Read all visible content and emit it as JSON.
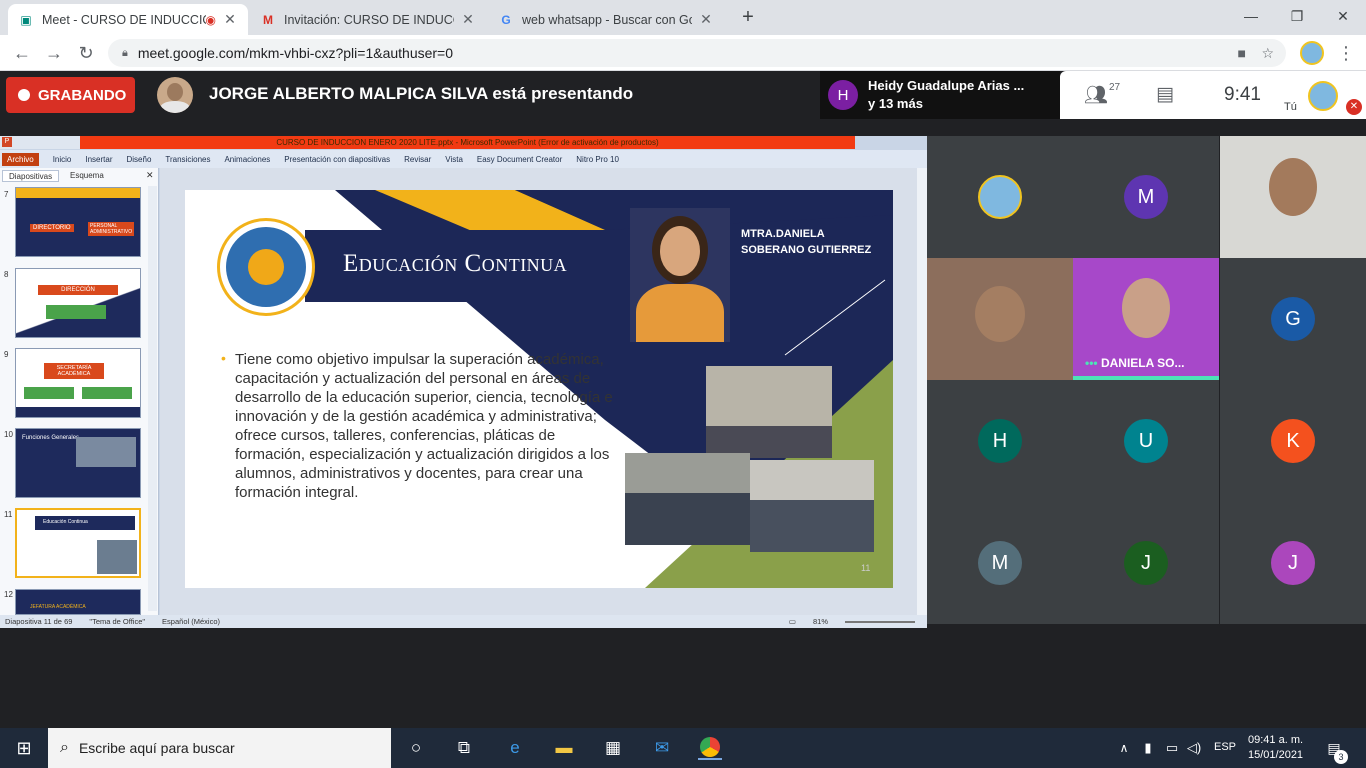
{
  "browser": {
    "tabs": [
      {
        "title": "Meet - CURSO DE INDUCCIÓN",
        "active": true
      },
      {
        "title": "Invitación: CURSO DE INDUCCIÓN"
      },
      {
        "title": "web whatsapp - Buscar con Google"
      }
    ],
    "url": "meet.google.com/mkm-vhbi-cxz?pli=1&authuser=0"
  },
  "meet": {
    "recording_label": "GRABANDO",
    "presenting_text": "JORGE ALBERTO MALPICA SILVA está presentando",
    "speaker_name": "Heidy Guadalupe Arias ...",
    "speaker_more": "y 13 más",
    "participants_count": "27",
    "time": "9:41",
    "you_label": "Tú",
    "tiles": [
      {
        "kind": "emblem"
      },
      {
        "kind": "letter",
        "letter": "M",
        "color": "#5e35b1"
      },
      {
        "kind": "video-man"
      },
      {
        "kind": "video-man2"
      },
      {
        "kind": "video-daniela",
        "label": "DANIELA SO..."
      },
      {
        "kind": "letter",
        "letter": "G",
        "color": "#1a5aa6"
      },
      {
        "kind": "letter",
        "letter": "H",
        "color": "#00695c"
      },
      {
        "kind": "letter",
        "letter": "U",
        "color": "#00838f"
      },
      {
        "kind": "letter",
        "letter": "K",
        "color": "#f4511e"
      },
      {
        "kind": "letter",
        "letter": "M",
        "color": "#546e7a"
      },
      {
        "kind": "letter",
        "letter": "J",
        "color": "#1b5e20"
      },
      {
        "kind": "letter",
        "letter": "J",
        "color": "#ab47bc"
      }
    ]
  },
  "ppt": {
    "window_title": "CURSO DE INDUCCION ENERO 2020 LITE.pptx - Microsoft PowerPoint (Error de activación de productos)",
    "ribbon_tabs": [
      "Archivo",
      "Inicio",
      "Insertar",
      "Diseño",
      "Transiciones",
      "Animaciones",
      "Presentación con diapositivas",
      "Revisar",
      "Vista",
      "Easy Document Creator",
      "Nitro Pro 10"
    ],
    "panel_tabs": [
      "Diapositivas",
      "Esquema"
    ],
    "thumbnails": [
      {
        "num": "7",
        "label": "DIRECTORIO",
        "label2": "PERSONAL ADMINISTRATIVO"
      },
      {
        "num": "8",
        "label": "DIRECCIÓN"
      },
      {
        "num": "9",
        "label": "SECRETARÍA ACADÉMICA"
      },
      {
        "num": "10",
        "label": "Funciones Generales"
      },
      {
        "num": "11",
        "label": "Educación Continua"
      },
      {
        "num": "12",
        "label": "JEFATURA ACADÉMICA"
      }
    ],
    "slide": {
      "title": "Educación Continua",
      "presenter_name_line1": "MTRA.DANIELA",
      "presenter_name_line2": "SOBERANO GUTIERREZ",
      "body": "Tiene como objetivo impulsar la superación académica, capacitación y actualización del personal en áreas de desarrollo de la educación superior, ciencia, tecnología e innovación y de la gestión académica y administrativa; ofrece cursos, talleres, conferencias, pláticas de formación, especialización y actualización dirigidos a los alumnos, administrativos y docentes, para crear una formación integral.",
      "number": "11"
    },
    "status": {
      "slide_of": "Diapositiva 11 de 69",
      "theme": "\"Tema de Office\"",
      "language": "Español (México)",
      "zoom": "81%"
    }
  },
  "taskbar": {
    "search_placeholder": "Escribe aquí para buscar",
    "lang": "ESP",
    "time": "09:41 a. m.",
    "date": "15/01/2021",
    "notifications": "3"
  }
}
